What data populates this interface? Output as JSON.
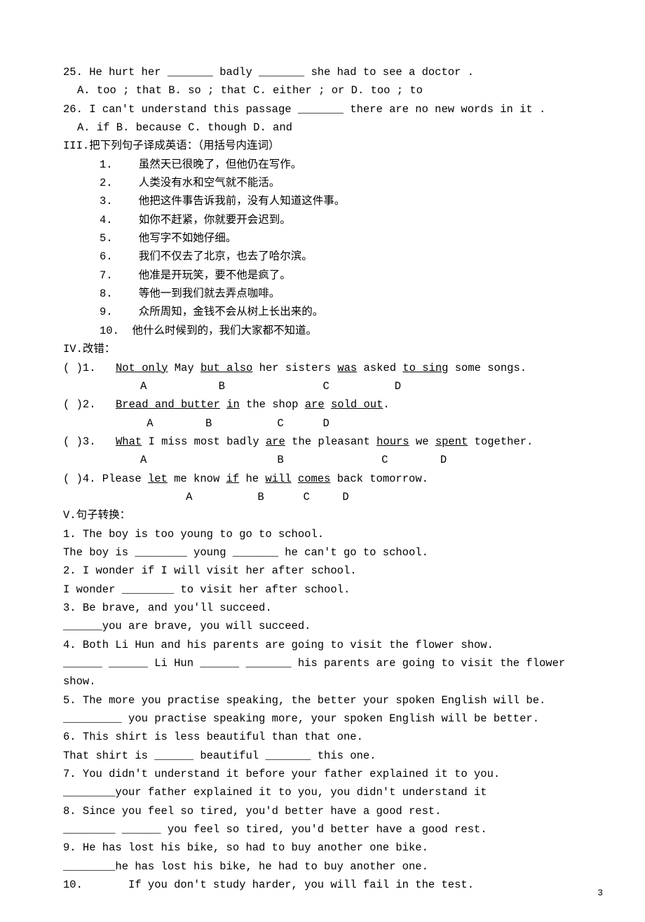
{
  "q25": {
    "stem": "25. He hurt her _______ badly _______ she had to see a doctor .",
    "choices": "  A. too ; that     B. so ; that      C. either ; or    D. too ; to"
  },
  "q26": {
    "stem": "26. I can't understand this passage _______ there are no new words in it .",
    "choices": "  A. if        B. because      C. though        D. and"
  },
  "s3": {
    "heading": "III.把下列句子译成英语：（用括号内连词）",
    "items": [
      "1.    虽然天已很晚了，但他仍在写作。",
      "2.    人类没有水和空气就不能活。",
      "3.    他把这件事告诉我前，没有人知道这件事。",
      "4.    如你不赶紧，你就要开会迟到。",
      "5.    他写字不如她仔细。",
      "6.    我们不仅去了北京，也去了哈尔滨。",
      "7.    他准是开玩笑，要不他是疯了。",
      "8.    等他一到我们就去弄点咖啡。",
      "9.    众所周知，金钱不会从树上长出来的。",
      "10.  他什么时候到的，我们大家都不知道。"
    ]
  },
  "s4": {
    "heading": "IV.改错：",
    "items": [
      {
        "t1": "(   )1. ",
        "p": [
          {
            "u": "Not only",
            "m": "  May  "
          },
          {
            "u": "but also",
            "m": "  her sisters  "
          },
          {
            "u": "was",
            "m": "  asked  "
          },
          {
            "u": "to sing",
            "m": "  some songs."
          }
        ],
        "letters": "A           B               C          D"
      },
      {
        "t1": "(   )2. ",
        "p": [
          {
            "u": "Bread and butter",
            "m": "  "
          },
          {
            "u": "in",
            "m": "  the shop  "
          },
          {
            "u": "are",
            "m": "   "
          },
          {
            "u": "sold out",
            "m": "."
          }
        ],
        "letters": " A        B          C      D"
      },
      {
        "t1": "(   )3. ",
        "p": [
          {
            "u": "What",
            "m": "  I miss most badly  "
          },
          {
            "u": "are",
            "m": "  the pleasant  "
          },
          {
            "u": "hours",
            "m": "  we  "
          },
          {
            "u": "spent",
            "m": "  together."
          }
        ],
        "letters": "A                    B               C        D"
      },
      {
        "t1": "(   )4. Please  ",
        "p": [
          {
            "u": "let",
            "m": "  me know  "
          },
          {
            "u": "if",
            "m": "  he  "
          },
          {
            "u": "will",
            "m": "  "
          },
          {
            "u": "comes",
            "m": "  back tomorrow."
          }
        ],
        "letters": "       A          B      C     D"
      }
    ]
  },
  "s5": {
    "heading": "V.句子转换：",
    "pairs": [
      {
        "a": "1. The boy is too young to go to school.",
        "b": "The boy is ________ young _______ he can't go to school."
      },
      {
        "a": "2. I wonder if I will visit her after school.",
        "b": "I wonder ________ to visit her after school."
      },
      {
        "a": "3. Be brave, and you'll succeed.",
        "b": "______you are brave, you will succeed."
      },
      {
        "a": "4. Both Li Hun and his parents are going to visit the flower show.",
        "b": "______ ______ Li Hun ______ _______ his parents are going to visit the flower show."
      },
      {
        "a": "5. The more you practise speaking, the better your spoken English will be.",
        "b": "_________ you practise speaking more, your spoken English will be better."
      },
      {
        "a": "6. This shirt is less beautiful than that one.",
        "b": "That shirt is ______ beautiful _______ this one."
      },
      {
        "a": "7. You didn't understand it before your father explained it to you.",
        "b": "________your father explained it to you, you didn't understand it"
      },
      {
        "a": "8. Since you feel so tired, you'd better have a good rest.",
        "b": "________ ______ you feel so tired, you'd better have a good rest."
      },
      {
        "a": "9. He has lost his bike, so had to buy another one bike.",
        "b": "________he has lost his bike, he had to buy another one."
      },
      {
        "a": "10.       If you don't study harder, you will fail in the test.",
        "b": ""
      }
    ]
  },
  "pagenum": "3"
}
